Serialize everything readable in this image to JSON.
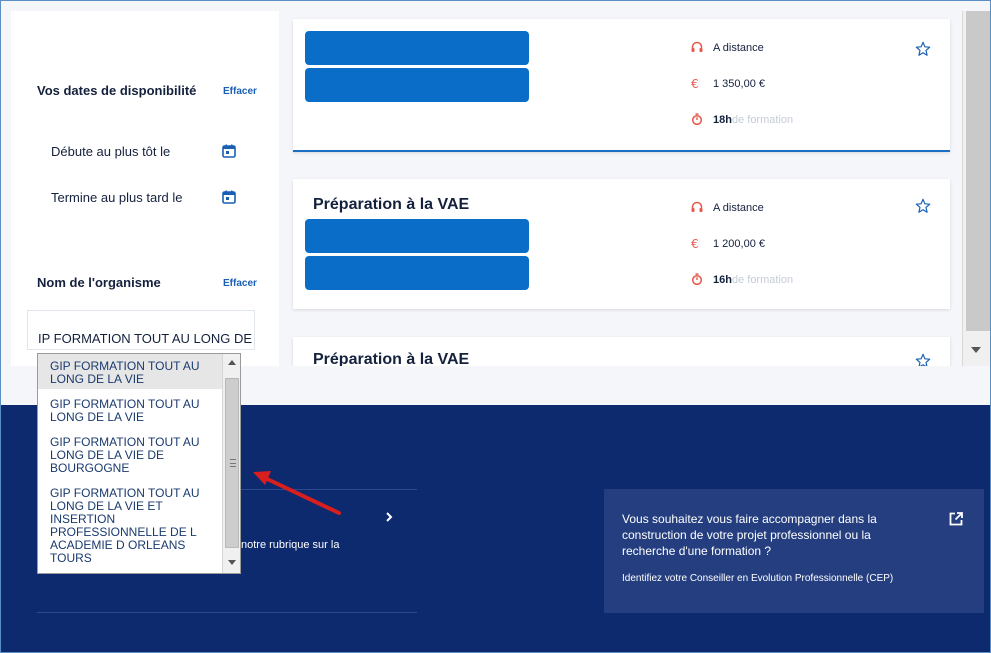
{
  "sidebar": {
    "dates_title": "Vos dates de disponibilité",
    "dates_clear": "Effacer",
    "start_label": "Débute au plus tôt le",
    "end_label": "Termine au plus tard le",
    "org_title": "Nom de l'organisme",
    "org_clear": "Effacer",
    "org_input_value": "IP FORMATION TOUT AU LONG DE"
  },
  "dropdown": {
    "options": [
      "GIP FORMATION TOUT AU LONG DE LA VIE",
      "GIP FORMATION TOUT AU LONG DE LA VIE",
      "GIP FORMATION TOUT AU LONG DE LA VIE DE BOURGOGNE",
      "GIP FORMATION TOUT AU LONG DE LA VIE ET INSERTION PROFESSIONNELLE DE L ACADEMIE D ORLEANS TOURS"
    ]
  },
  "cards": [
    {
      "title": "",
      "mode": "A distance",
      "price": "1 350,00 €",
      "hours": "18h",
      "hours_suffix": "de formation"
    },
    {
      "title": "Préparation à la VAE",
      "mode": "A distance",
      "price": "1 200,00 €",
      "hours": "16h",
      "hours_suffix": "de formation"
    },
    {
      "title": "Préparation à la VAE"
    }
  ],
  "footer": {
    "partial_text": "notre rubrique sur la",
    "cep_text": "Vous souhaitez vous faire accompagner dans la construction de votre projet professionnel ou la recherche d'une formation ?",
    "cep_link": "Identifiez votre Conseiller en Evolution Professionnelle (CEP)"
  },
  "colors": {
    "accent_blue": "#0a6ec8",
    "footer_navy": "#0e2a6e",
    "icon_red": "#e8584a",
    "annotation_red": "#d81e1e"
  },
  "icons": [
    "calendar-icon",
    "headset-icon",
    "euro-icon",
    "stopwatch-icon",
    "star-icon",
    "chevron-right-icon",
    "external-link-icon"
  ]
}
